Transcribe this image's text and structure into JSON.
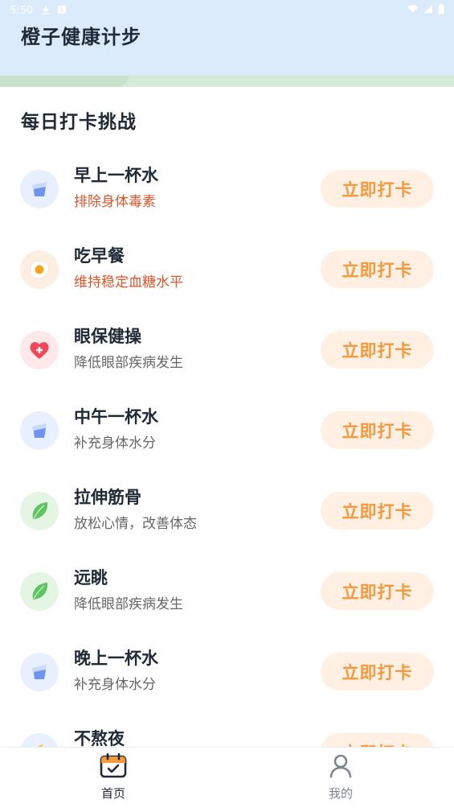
{
  "status_bar": {
    "time": "5:50",
    "icons": [
      "download-icon",
      "notification-a-icon",
      "wifi-icon",
      "signal-icon",
      "battery-icon"
    ]
  },
  "header": {
    "title": "橙子健康计步"
  },
  "section": {
    "title": "每日打卡挑战"
  },
  "tasks": [
    {
      "name": "早上一杯水",
      "desc": "排除身体毒素",
      "icon": "water-glass-icon",
      "highlight": true,
      "button": "立即打卡"
    },
    {
      "name": "吃早餐",
      "desc": "维持稳定血糖水平",
      "icon": "fried-egg-icon",
      "highlight": true,
      "button": "立即打卡"
    },
    {
      "name": "眼保健操",
      "desc": "降低眼部疾病发生",
      "icon": "heart-plus-icon",
      "highlight": false,
      "button": "立即打卡"
    },
    {
      "name": "中午一杯水",
      "desc": "补充身体水分",
      "icon": "water-glass-icon",
      "highlight": false,
      "button": "立即打卡"
    },
    {
      "name": "拉伸筋骨",
      "desc": "放松心情，改善体态",
      "icon": "leaf-icon",
      "highlight": false,
      "button": "立即打卡"
    },
    {
      "name": "远眺",
      "desc": "降低眼部疾病发生",
      "icon": "leaf-icon",
      "highlight": false,
      "button": "立即打卡"
    },
    {
      "name": "晚上一杯水",
      "desc": "补充身体水分",
      "icon": "water-glass-icon",
      "highlight": false,
      "button": "立即打卡"
    },
    {
      "name": "不熬夜",
      "desc": "",
      "icon": "moon-icon",
      "highlight": false,
      "button": "立即打卡"
    }
  ],
  "bottom_nav": {
    "items": [
      {
        "label": "首页",
        "icon": "calendar-check-icon",
        "active": true
      },
      {
        "label": "我的",
        "icon": "user-icon",
        "active": false
      }
    ]
  },
  "colors": {
    "header_bg": "#dcebfb",
    "accent_orange": "#f29a3d",
    "button_bg": "#fff0e3",
    "highlight_red": "#e0542a"
  }
}
